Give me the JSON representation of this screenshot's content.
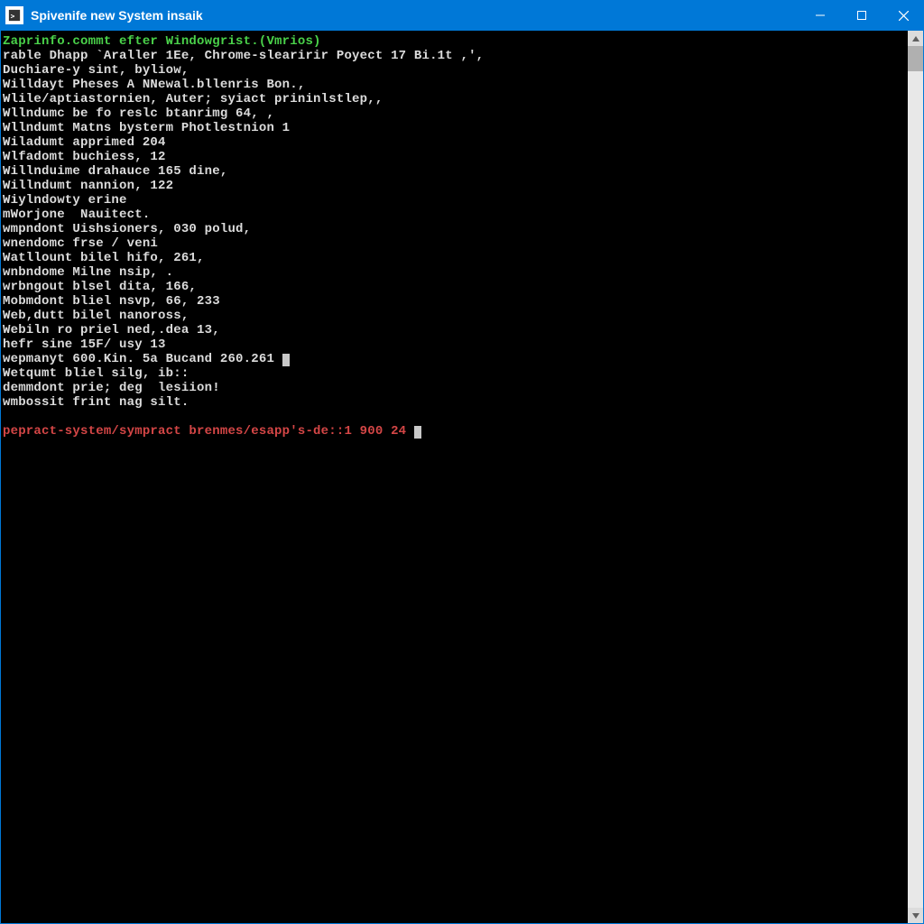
{
  "titlebar": {
    "title": "Spivenife new System insaik",
    "icon_label": "C:\\"
  },
  "terminal": {
    "header": "Zaprinfo.commt efter Windowgrist.(Vmrios)",
    "lines": [
      "rable Dhapp `Araller 1Ee, Chrome-slearirir Poyect 17 Bi.1t ,',",
      "Duchiare-y sint, byliow,",
      "Willdayt Pheses A NNewal.bllenris Bon.,",
      "Wlile/aptiastornien, Auter; syiact prininlstlep,,",
      "Wllndumc be fo reslc btanrimg 64, ,",
      "Wllndumt Matns bysterm Photlestnion 1",
      "Wiladumt apprimed 204",
      "Wlfadomt buchiess, 12",
      "Willnduime drahauce 165 dine,",
      "Willndumt nannion, 122",
      "Wiylndowty erine",
      "mWorjone  Nauitect.",
      "wmpndont Uishsioners, 030 polud,",
      "wnendomc frse / veni",
      "Watllount bilel hifo, 261,",
      "wnbndome Milne nsip, .",
      "wrbngout blsel dita, 166,",
      "Mobmdont bliel nsvp, 66, 233",
      "Web,dutt bilel nanoross,",
      "Webiln ro priel ned,.dea 13,",
      "hefr sine 15F/ usy 13",
      "wepmanyt 600.Kin. 5a Bucand 260.261 ",
      "Wetqumt bliel silg, ib::",
      "demmdont prie; deg  lesiion!",
      "wmbossit frint nag silt."
    ],
    "prompt": "pepract-system/sympract brenmes/esapp's-de::1 900 24 "
  }
}
